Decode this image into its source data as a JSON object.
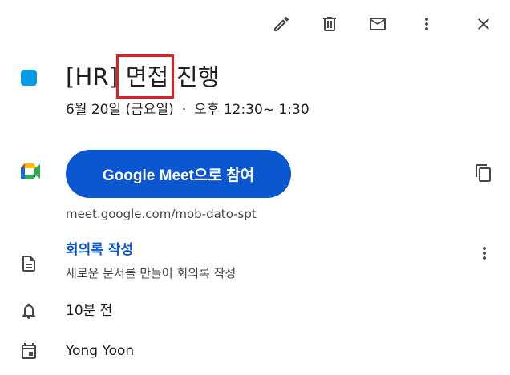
{
  "toolbar": {
    "edit_icon": "pencil-icon",
    "delete_icon": "trash-icon",
    "email_icon": "mail-icon",
    "more_icon": "more-vert-icon",
    "close_icon": "close-icon"
  },
  "event": {
    "calendar_color": "#039be5",
    "title": "[HR] 면접 진행",
    "date": "6월 20일 (금요일)",
    "separator": "·",
    "time": "오후 12:30~ 1:30"
  },
  "meet": {
    "join_label": "Google Meet으로 참여",
    "url": "meet.google.com/mob-dato-spt",
    "button_color": "#0b57d0"
  },
  "notes": {
    "link_label": "회의록 작성",
    "description": "새로운 문서를 만들어 회의록 작성"
  },
  "reminder": {
    "text": "10분 전"
  },
  "calendar": {
    "owner": "Yong Yoon"
  },
  "annotation": {
    "highlight_color": "#e02020"
  }
}
